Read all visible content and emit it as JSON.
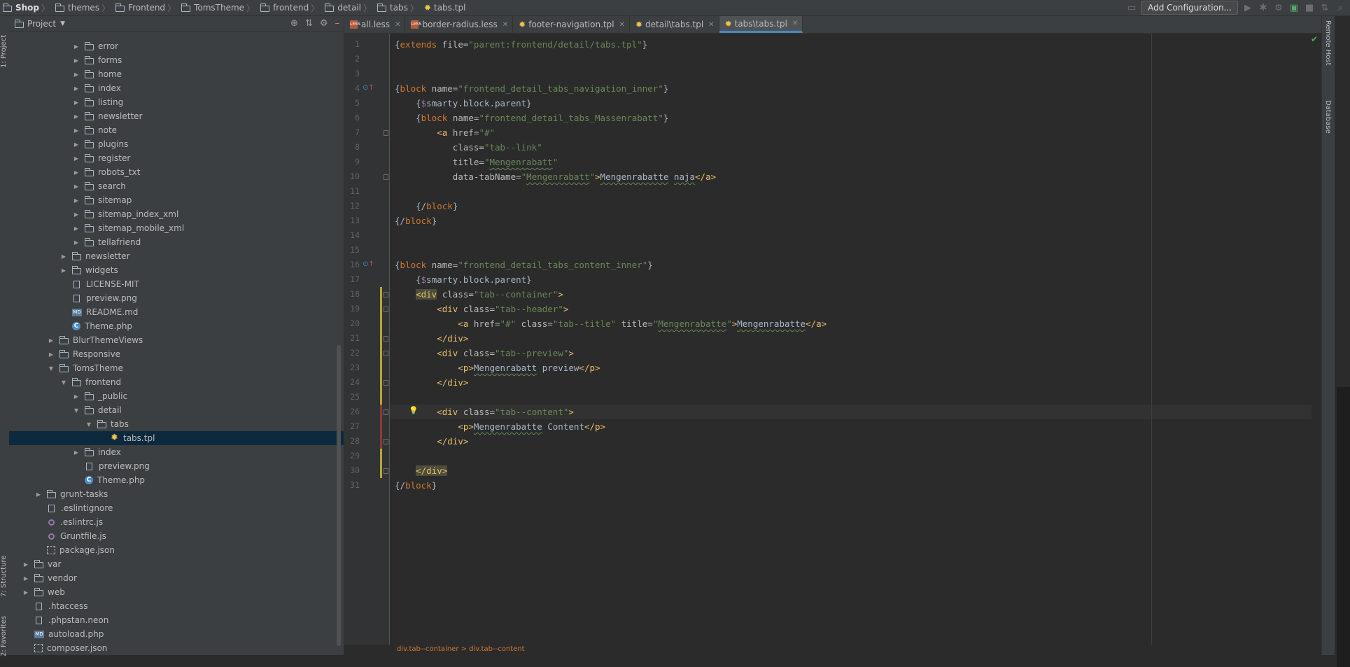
{
  "breadcrumb": {
    "items": [
      "Shop",
      "themes",
      "Frontend",
      "TomsTheme",
      "frontend",
      "detail",
      "tabs",
      "tabs.tpl"
    ]
  },
  "toolbar": {
    "config_label": "Add Configuration..."
  },
  "left_strip": {
    "project": "1: Project",
    "structure": "7: Structure",
    "favorites": "2: Favorites"
  },
  "right_strip": {
    "remote": "Remote Host",
    "database": "Database"
  },
  "project_panel": {
    "title": "Project",
    "rows": [
      {
        "label": "error",
        "type": "folder",
        "indent": 5,
        "arrow": "right"
      },
      {
        "label": "forms",
        "type": "folder",
        "indent": 5,
        "arrow": "right"
      },
      {
        "label": "home",
        "type": "folder",
        "indent": 5,
        "arrow": "right"
      },
      {
        "label": "index",
        "type": "folder",
        "indent": 5,
        "arrow": "right"
      },
      {
        "label": "listing",
        "type": "folder",
        "indent": 5,
        "arrow": "right"
      },
      {
        "label": "newsletter",
        "type": "folder",
        "indent": 5,
        "arrow": "right"
      },
      {
        "label": "note",
        "type": "folder",
        "indent": 5,
        "arrow": "right"
      },
      {
        "label": "plugins",
        "type": "folder",
        "indent": 5,
        "arrow": "right"
      },
      {
        "label": "register",
        "type": "folder",
        "indent": 5,
        "arrow": "right"
      },
      {
        "label": "robots_txt",
        "type": "folder",
        "indent": 5,
        "arrow": "right"
      },
      {
        "label": "search",
        "type": "folder",
        "indent": 5,
        "arrow": "right"
      },
      {
        "label": "sitemap",
        "type": "folder",
        "indent": 5,
        "arrow": "right"
      },
      {
        "label": "sitemap_index_xml",
        "type": "folder",
        "indent": 5,
        "arrow": "right"
      },
      {
        "label": "sitemap_mobile_xml",
        "type": "folder",
        "indent": 5,
        "arrow": "right"
      },
      {
        "label": "tellafriend",
        "type": "folder",
        "indent": 5,
        "arrow": "right"
      },
      {
        "label": "newsletter",
        "type": "folder",
        "indent": 4,
        "arrow": "right"
      },
      {
        "label": "widgets",
        "type": "folder",
        "indent": 4,
        "arrow": "right"
      },
      {
        "label": "LICENSE-MIT",
        "type": "file",
        "indent": 4,
        "arrow": ""
      },
      {
        "label": "preview.png",
        "type": "file",
        "indent": 4,
        "arrow": ""
      },
      {
        "label": "README.md",
        "type": "md",
        "indent": 4,
        "arrow": ""
      },
      {
        "label": "Theme.php",
        "type": "php",
        "indent": 4,
        "arrow": ""
      },
      {
        "label": "BlurThemeViews",
        "type": "folder",
        "indent": 3,
        "arrow": "right"
      },
      {
        "label": "Responsive",
        "type": "folder",
        "indent": 3,
        "arrow": "right"
      },
      {
        "label": "TomsTheme",
        "type": "folder",
        "indent": 3,
        "arrow": "down"
      },
      {
        "label": "frontend",
        "type": "folder",
        "indent": 4,
        "arrow": "down"
      },
      {
        "label": "_public",
        "type": "folder",
        "indent": 5,
        "arrow": "right"
      },
      {
        "label": "detail",
        "type": "folder",
        "indent": 5,
        "arrow": "down"
      },
      {
        "label": "tabs",
        "type": "folder",
        "indent": 6,
        "arrow": "down"
      },
      {
        "label": "tabs.tpl",
        "type": "tpl",
        "indent": 7,
        "arrow": "",
        "selected": true
      },
      {
        "label": "index",
        "type": "folder",
        "indent": 5,
        "arrow": "right"
      },
      {
        "label": "preview.png",
        "type": "file",
        "indent": 5,
        "arrow": ""
      },
      {
        "label": "Theme.php",
        "type": "php",
        "indent": 5,
        "arrow": ""
      },
      {
        "label": "grunt-tasks",
        "type": "folder",
        "indent": 2,
        "arrow": "right"
      },
      {
        "label": ".eslintignore",
        "type": "file",
        "indent": 2,
        "arrow": ""
      },
      {
        "label": ".eslintrc.js",
        "type": "js",
        "indent": 2,
        "arrow": ""
      },
      {
        "label": "Gruntfile.js",
        "type": "js",
        "indent": 2,
        "arrow": ""
      },
      {
        "label": "package.json",
        "type": "json",
        "indent": 2,
        "arrow": ""
      },
      {
        "label": "var",
        "type": "folder",
        "indent": 1,
        "arrow": "right"
      },
      {
        "label": "vendor",
        "type": "folder",
        "indent": 1,
        "arrow": "right"
      },
      {
        "label": "web",
        "type": "folder",
        "indent": 1,
        "arrow": "right"
      },
      {
        "label": ".htaccess",
        "type": "file",
        "indent": 1,
        "arrow": ""
      },
      {
        "label": ".phpstan.neon",
        "type": "file",
        "indent": 1,
        "arrow": ""
      },
      {
        "label": "autoload.php",
        "type": "md",
        "indent": 1,
        "arrow": ""
      },
      {
        "label": "composer.json",
        "type": "json",
        "indent": 1,
        "arrow": ""
      }
    ]
  },
  "tabs": [
    {
      "label": "all.less",
      "icon": "less",
      "active": false
    },
    {
      "label": "border-radius.less",
      "icon": "less",
      "active": false
    },
    {
      "label": "footer-navigation.tpl",
      "icon": "tpl",
      "active": false
    },
    {
      "label": "detail\\tabs.tpl",
      "icon": "tpl",
      "active": false
    },
    {
      "label": "tabs\\tabs.tpl",
      "icon": "tpl",
      "active": true
    }
  ],
  "editor": {
    "current_line": 26,
    "lines": [
      {
        "n": 1,
        "html": "<span class='p'>{</span><span class='k'>extends</span> <span class='a'>file=</span><span class='s'>\"parent:frontend/detail/tabs.tpl\"</span><span class='p'>}</span>"
      },
      {
        "n": 2,
        "html": ""
      },
      {
        "n": 3,
        "html": ""
      },
      {
        "n": 4,
        "html": "<span class='p'>{</span><span class='k'>block</span> <span class='a'>name=</span><span class='s'>\"frontend_detail_tabs_navigation_inner\"</span><span class='p'>}</span>"
      },
      {
        "n": 5,
        "html": "    <span class='p'>{</span><span class='v'>$</span><span class='p'>smarty.block.parent}</span>"
      },
      {
        "n": 6,
        "html": "    <span class='p'>{</span><span class='k'>block</span> <span class='a'>name=</span><span class='s'>\"frontend_detail_tabs_Massenrabatt\"</span><span class='p'>}</span>"
      },
      {
        "n": 7,
        "html": "        <span class='t'>&lt;a</span> <span class='a'>href=</span><span class='s'>\"#\"</span>"
      },
      {
        "n": 8,
        "html": "           <span class='a'>class=</span><span class='s'>\"tab--link\"</span>"
      },
      {
        "n": 9,
        "html": "           <span class='a'>title=</span><span class='s'>\"<span class='w'>Mengenrabatt</span>\"</span>"
      },
      {
        "n": 10,
        "html": "           <span class='a'>data-tabName=</span><span class='s'>\"<span class='w'>Mengenrabatt</span>\"</span><span class='t'>&gt;</span><span class='p'><span class='w'>Mengenrabatte</span> <span class='w'>naja</span></span><span class='t'>&lt;/a&gt;</span>"
      },
      {
        "n": 11,
        "html": ""
      },
      {
        "n": 12,
        "html": "    <span class='p'>{/</span><span class='k'>block</span><span class='p'>}</span>"
      },
      {
        "n": 13,
        "html": "<span class='p'>{/</span><span class='k'>block</span><span class='p'>}</span>"
      },
      {
        "n": 14,
        "html": ""
      },
      {
        "n": 15,
        "html": ""
      },
      {
        "n": 16,
        "html": "<span class='p'>{</span><span class='k'>block</span> <span class='a'>name=</span><span class='s'>\"frontend_detail_tabs_content_inner\"</span><span class='p'>}</span>"
      },
      {
        "n": 17,
        "html": "    <span class='p'>{</span><span class='v'>$</span><span class='p'>smarty.block.parent}</span>"
      },
      {
        "n": 18,
        "html": "    <span class='t hl2'>&lt;div</span> <span class='a'>class=</span><span class='s'>\"tab--container\"</span><span class='t'>&gt;</span>"
      },
      {
        "n": 19,
        "html": "        <span class='t'>&lt;div</span> <span class='a'>class=</span><span class='s'>\"tab--header\"</span><span class='t'>&gt;</span>"
      },
      {
        "n": 20,
        "html": "            <span class='t'>&lt;a</span> <span class='a'>href=</span><span class='s'>\"#\"</span> <span class='a'>class=</span><span class='s'>\"tab--title\"</span> <span class='a'>title=</span><span class='s'>\"<span class='w'>Mengenrabatte</span>\"</span><span class='t'>&gt;</span><span class='p w'>Mengenrabatte</span><span class='t'>&lt;/a&gt;</span>"
      },
      {
        "n": 21,
        "html": "        <span class='t'>&lt;/div&gt;</span>"
      },
      {
        "n": 22,
        "html": "        <span class='t'>&lt;div</span> <span class='a'>class=</span><span class='s'>\"tab--preview\"</span><span class='t'>&gt;</span>"
      },
      {
        "n": 23,
        "html": "            <span class='t'>&lt;p&gt;</span><span class='p'><span class='w'>Mengenrabatt</span> preview</span><span class='t'>&lt;/p&gt;</span>"
      },
      {
        "n": 24,
        "html": "        <span class='t'>&lt;/div&gt;</span>"
      },
      {
        "n": 25,
        "html": ""
      },
      {
        "n": 26,
        "html": "        <span class='t'>&lt;div</span> <span class='a'>class=</span><span class='s'>\"tab--content\"</span><span class='t'>&gt;</span>"
      },
      {
        "n": 27,
        "html": "            <span class='t'>&lt;p&gt;</span><span class='p'><span class='w'>Mengenrabatte</span> Content</span><span class='t'>&lt;/p&gt;</span>"
      },
      {
        "n": 28,
        "html": "        <span class='t'>&lt;/div&gt;</span>"
      },
      {
        "n": 29,
        "html": ""
      },
      {
        "n": 30,
        "html": "    <span class='t hl2'>&lt;/div&gt;</span>"
      },
      {
        "n": 31,
        "html": "<span class='p'>{/</span><span class='k'>block</span><span class='p'>}</span>"
      }
    ]
  },
  "status_crumb": "div.tab--container  >  div.tab--content",
  "colors": {
    "accent": "#4a88c7",
    "keyword": "#cc7832",
    "string": "#6a8759",
    "tag": "#e8bf6a",
    "selection": "#0d293e"
  }
}
